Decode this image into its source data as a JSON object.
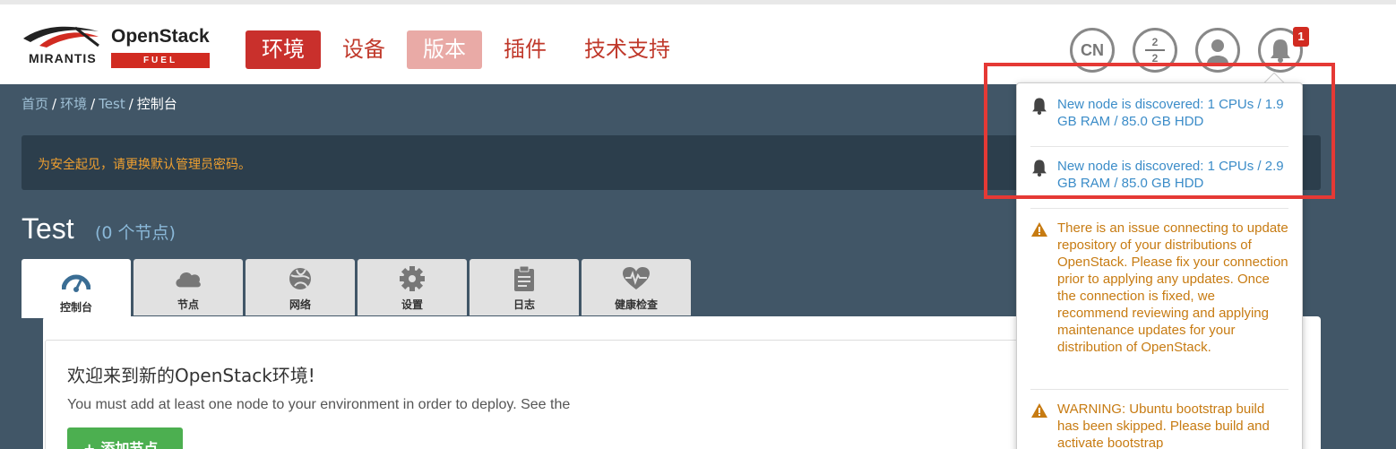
{
  "brand": {
    "mirantis": "MIRANTIS",
    "product": "OpenStack",
    "sub": "FUEL"
  },
  "nav": {
    "items": [
      {
        "label": "环境",
        "state": "active"
      },
      {
        "label": "设备",
        "state": "normal"
      },
      {
        "label": "版本",
        "state": "dim"
      },
      {
        "label": "插件",
        "state": "normal"
      },
      {
        "label": "技术支持",
        "state": "normal"
      }
    ]
  },
  "header_icons": {
    "language": "CN",
    "stats_top": "2",
    "stats_bottom": "2",
    "notifications_count": "1"
  },
  "breadcrumb": {
    "home": "首页",
    "envs": "环境",
    "env": "Test",
    "current": "控制台"
  },
  "alert": {
    "text": "为安全起见，请更换默认管理员密码。"
  },
  "environment": {
    "name": "Test",
    "node_count": "(0 个节点)"
  },
  "tabs": [
    {
      "label": "控制台",
      "icon": "dashboard-icon"
    },
    {
      "label": "节点",
      "icon": "cloud-icon"
    },
    {
      "label": "网络",
      "icon": "network-icon"
    },
    {
      "label": "设置",
      "icon": "gear-icon"
    },
    {
      "label": "日志",
      "icon": "clipboard-icon"
    },
    {
      "label": "健康检查",
      "icon": "heart-icon"
    }
  ],
  "welcome": {
    "title": "欢迎来到新的OpenStack环境!",
    "desc": "You must add at least one node to your environment in order to deploy. See the",
    "add_button": "添加节点"
  },
  "notifications": [
    {
      "type": "info",
      "text": "New node is discovered: 1 CPUs / 1.9 GB RAM / 85.0 GB HDD"
    },
    {
      "type": "info",
      "text": "New node is discovered: 1 CPUs / 2.9 GB RAM / 85.0 GB HDD"
    },
    {
      "type": "warn",
      "text": "There is an issue connecting to update repository of your distributions of OpenStack. Please fix your connection prior to applying any updates. Once the connection is fixed, we recommend reviewing and applying maintenance updates for your distribution of OpenStack."
    },
    {
      "type": "warn",
      "text": "WARNING: Ubuntu bootstrap build has been skipped. Please build and activate bootstrap"
    }
  ],
  "colors": {
    "accent": "#c9302c",
    "bg": "#415667",
    "info": "#3b8cc8",
    "warn": "#c77b12"
  }
}
